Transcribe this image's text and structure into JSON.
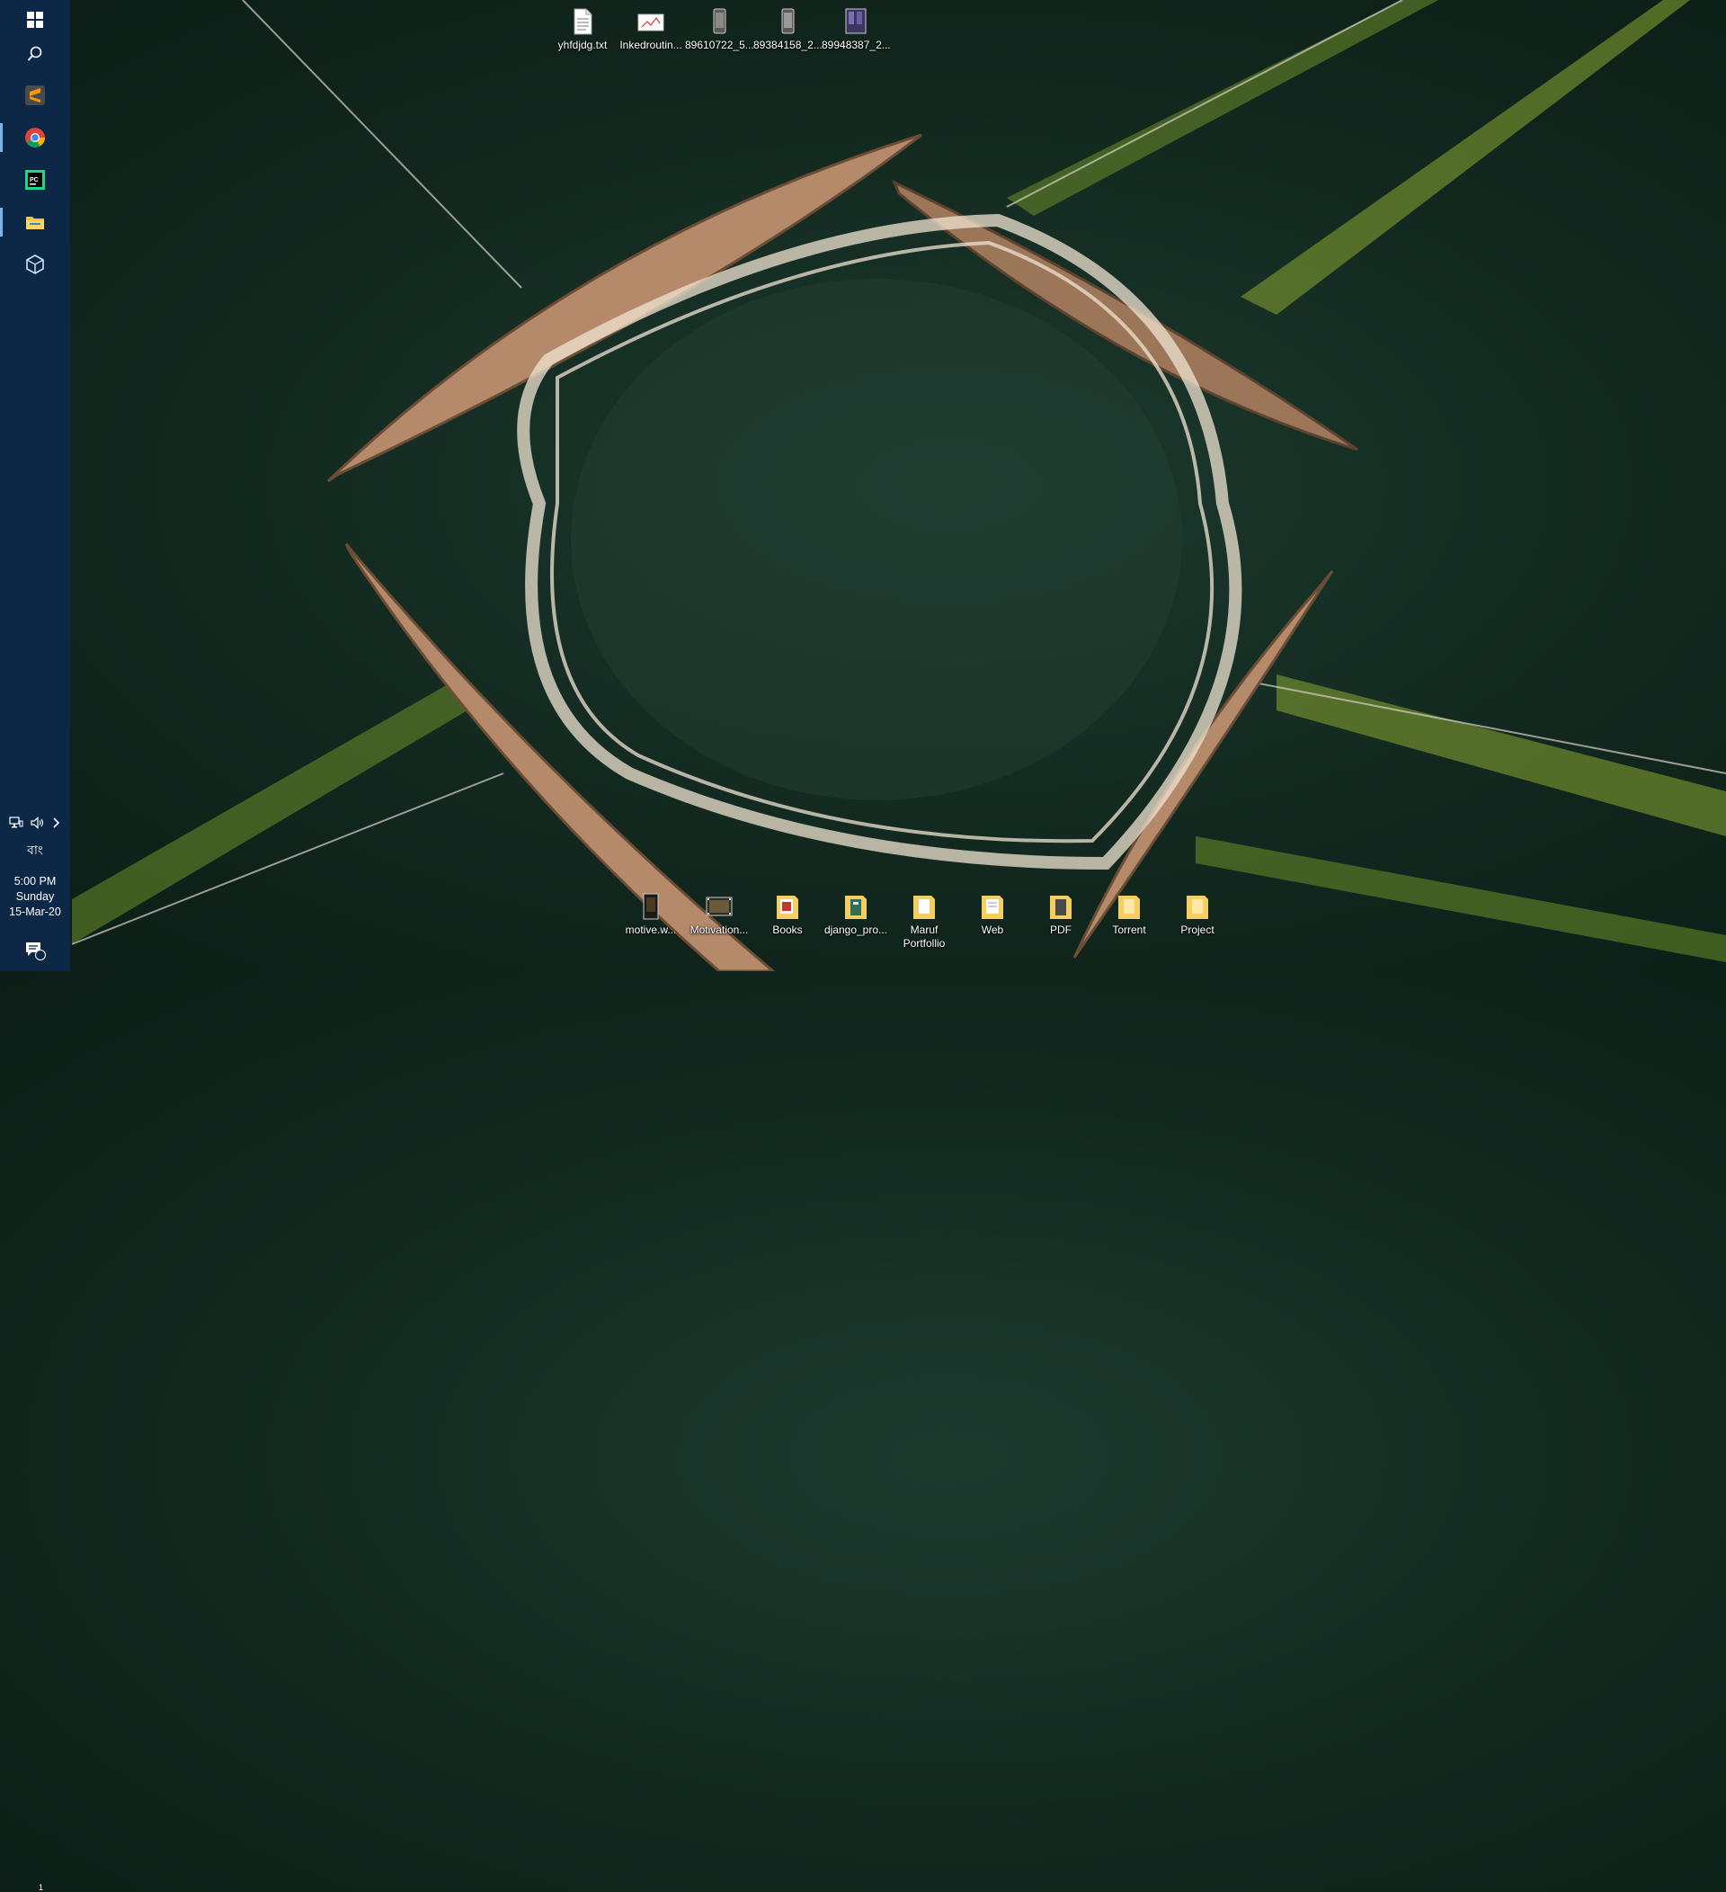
{
  "taskbar": {
    "pinned": [
      {
        "name": "start-windows-icon"
      },
      {
        "name": "search-icon"
      },
      {
        "name": "sublime-text-icon"
      },
      {
        "name": "chrome-icon"
      },
      {
        "name": "pycharm-icon"
      },
      {
        "name": "file-explorer-icon"
      },
      {
        "name": "virtualbox-icon"
      }
    ],
    "tray": {
      "language": "বাং",
      "time": "5:00 PM",
      "day": "Sunday",
      "date": "15-Mar-20",
      "notification_count": "1"
    }
  },
  "desktop_top": [
    {
      "label": "yhfdjdg.txt",
      "icon": "text-file-icon"
    },
    {
      "label": "Inkedroutin...",
      "icon": "image-file-icon"
    },
    {
      "label": "89610722_5...",
      "icon": "phone-image-icon"
    },
    {
      "label": "89384158_2...",
      "icon": "phone-image-icon"
    },
    {
      "label": "89948387_2...",
      "icon": "photo-image-icon"
    }
  ],
  "desktop_bottom": [
    {
      "label": "motive.w...",
      "icon": "video-file-icon"
    },
    {
      "label": "Motivation...",
      "icon": "video-file-icon"
    },
    {
      "label": "Books",
      "icon": "folder-icon"
    },
    {
      "label": "django_pro...",
      "icon": "folder-icon"
    },
    {
      "label": "Maruf Portfollio",
      "icon": "folder-icon"
    },
    {
      "label": "Web",
      "icon": "folder-icon"
    },
    {
      "label": "PDF",
      "icon": "folder-icon"
    },
    {
      "label": "Torrent",
      "icon": "folder-icon"
    },
    {
      "label": "Project",
      "icon": "folder-icon"
    }
  ]
}
